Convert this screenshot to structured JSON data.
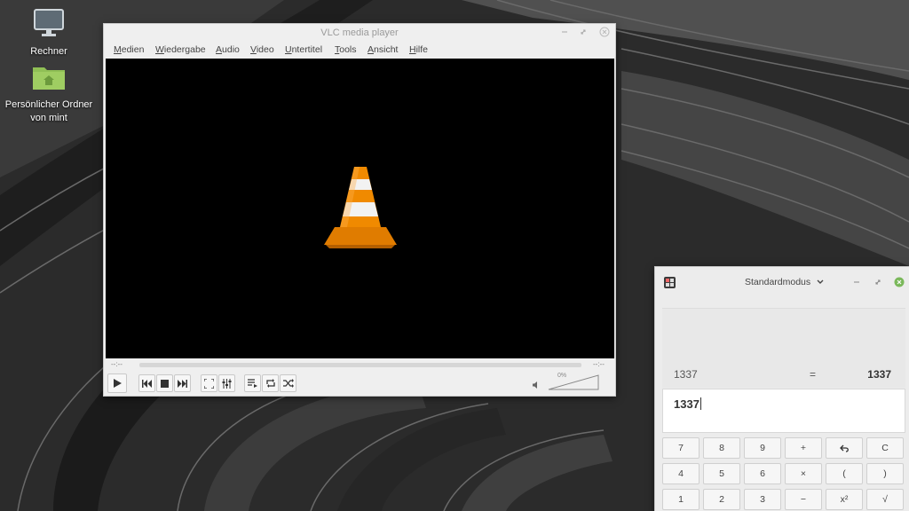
{
  "desktop": {
    "icons": [
      {
        "label": "Rechner",
        "icon": "computer-icon"
      },
      {
        "label": "Persönlicher Ordner von mint",
        "icon": "home-folder-icon"
      }
    ]
  },
  "vlc": {
    "title": "VLC media player",
    "menu": [
      "Medien",
      "Wiedergabe",
      "Audio",
      "Video",
      "Untertitel",
      "Tools",
      "Ansicht",
      "Hilfe"
    ],
    "time_elapsed": "--:--",
    "time_total": "--:--",
    "volume_label": "0%",
    "volume_level": 0,
    "controls": [
      "play-icon",
      "previous-icon",
      "stop-icon",
      "next-icon",
      "fullscreen-icon",
      "extended-settings-icon",
      "playlist-icon",
      "loop-icon",
      "shuffle-icon",
      "speaker-icon"
    ]
  },
  "calculator": {
    "mode": "Standardmodus",
    "history_expression": "1337",
    "history_equals": "=",
    "history_result": "1337",
    "entry": "1337",
    "keys": [
      [
        "7",
        "8",
        "9",
        "+",
        "↶",
        "C"
      ],
      [
        "4",
        "5",
        "6",
        "×",
        "(",
        ")"
      ],
      [
        "1",
        "2",
        "3",
        "−",
        "x²",
        "√"
      ]
    ]
  },
  "colors": {
    "vlc_cone_orange": "#f08a00",
    "calc_close_green": "#7ab85a",
    "folder_green": "#8fbf55"
  }
}
